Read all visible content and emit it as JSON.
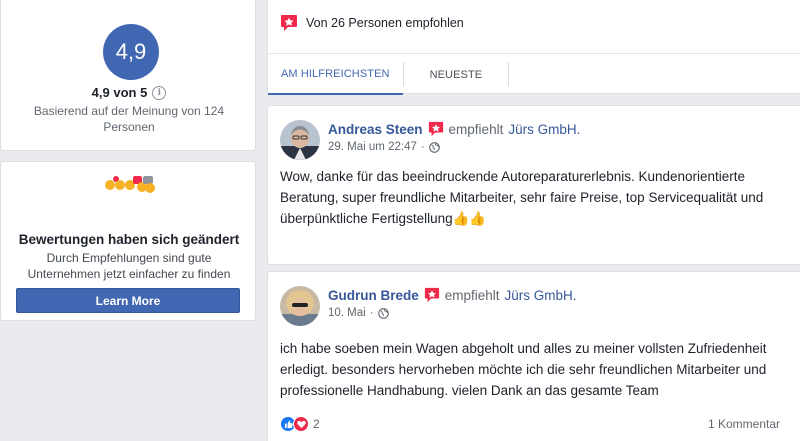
{
  "rating": {
    "score": "4,9",
    "summary": "4,9 von 5",
    "basis": "Basierend auf der Meinung von 124 Personen",
    "info_icon": "info-icon"
  },
  "change_notice": {
    "title": "Bewertungen haben sich geändert",
    "description": "Durch Empfehlungen sind gute Unternehmen jetzt einfacher zu finden",
    "button_label": "Learn More"
  },
  "recommendations": {
    "header": "Von 26 Personen empfohlen",
    "tabs": [
      {
        "label": "AM HILFREICHSTEN",
        "active": true
      },
      {
        "label": "NEUESTE",
        "active": false
      }
    ]
  },
  "reviews": [
    {
      "name": "Andreas Steen",
      "verb": "empfiehlt",
      "page": "Jürs GmbH.",
      "date": "29. Mai um 22:47",
      "text": "Wow, danke für das beeindruckende Autoreparaturerlebnis. Kundenorientierte Beratung, super freundliche Mitarbeiter, sehr faire Preise, top Servicequalität und überpünktliche Fertigstellung👍👍"
    },
    {
      "name": "Gudrun Brede",
      "verb": "empfiehlt",
      "page": "Jürs GmbH.",
      "date": "10. Mai",
      "text": "ich habe soeben mein Wagen abgeholt und alles zu meiner vollsten Zufriedenheit erledigt. besonders hervorheben möchte ich die sehr freundlichen Mitarbeiter und professionelle Handhabung. vielen Dank an das gesamte Team",
      "reaction_count": "2",
      "comments": "1 Kommentar"
    }
  ],
  "colors": {
    "brand_blue": "#4267b2",
    "link_blue": "#365899",
    "recommend_red": "#f02849",
    "background": "#e9ebee"
  }
}
